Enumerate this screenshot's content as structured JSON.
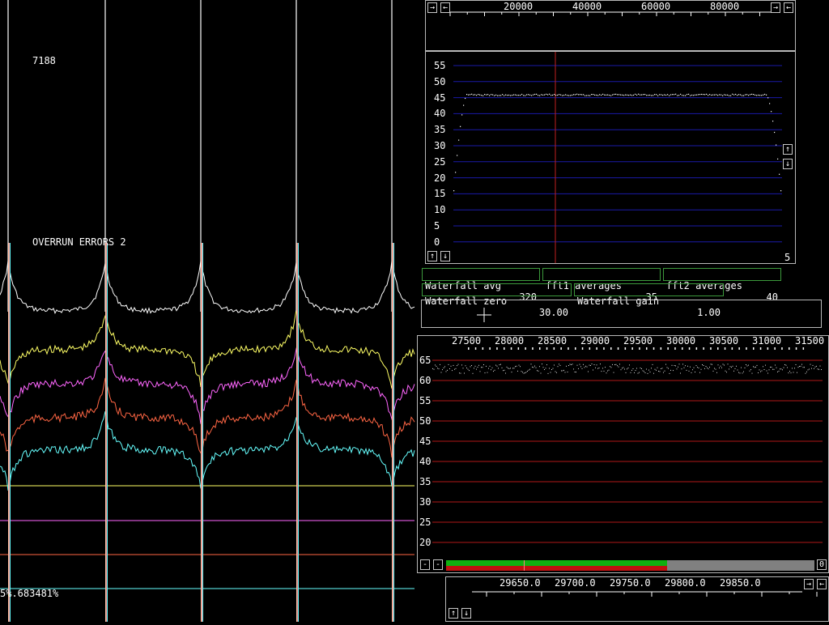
{
  "timeplot": {
    "counter": "7188",
    "overrun": "OVERRUN ERRORS 2",
    "readout": "5%.683481%",
    "trace_colors": [
      "#ffffff",
      "#ffff66",
      "#ff66ff",
      "#ff6644",
      "#66ffff"
    ]
  },
  "top_scale": {
    "ticks": [
      "20000",
      "40000",
      "60000",
      "80000"
    ],
    "left_buttons": [
      "→",
      "←"
    ],
    "right_buttons": [
      "→",
      "←"
    ]
  },
  "spectrum1": {
    "y_labels": [
      "55",
      "50",
      "45",
      "40",
      "35",
      "30",
      "25",
      "20",
      "15",
      "10",
      "5",
      "0"
    ],
    "corner_value": "5",
    "level_value": 46,
    "buttons_bottom": [
      "↑",
      "↓"
    ],
    "buttons_right": [
      "↑",
      "↓"
    ],
    "grid_color": "#1a1aa8",
    "marker_color": "#c02020"
  },
  "params": {
    "waterfall_avg": {
      "label": "Waterfall avg",
      "value": "320"
    },
    "fft1_averages": {
      "label": "fft1 averages",
      "value": "35"
    },
    "fft2_averages": {
      "label": "fft2 averages",
      "value": "40"
    },
    "waterfall_zero": {
      "label": "Waterfall zero",
      "value": "30.00"
    },
    "waterfall_gain": {
      "label": "Waterfall gain",
      "value": "1.00"
    }
  },
  "spectrum2": {
    "x_ticks": [
      "27500",
      "28000",
      "28500",
      "29000",
      "29500",
      "30000",
      "30500",
      "31000",
      "31500"
    ],
    "y_labels": [
      "65",
      "60",
      "55",
      "50",
      "45",
      "40",
      "35",
      "30",
      "25",
      "20"
    ],
    "grid_color": "#b01818",
    "level_value": 63,
    "minus_buttons": [
      "-",
      "-"
    ],
    "zero_button": "0",
    "bar_fill_fraction": 0.6
  },
  "bottom_scale": {
    "ticks": [
      "29650.0",
      "29700.0",
      "29750.0",
      "29800.0",
      "29850.0"
    ],
    "buttons_left": [
      "↑",
      "↓"
    ],
    "buttons_right": [
      "→",
      "←"
    ]
  }
}
